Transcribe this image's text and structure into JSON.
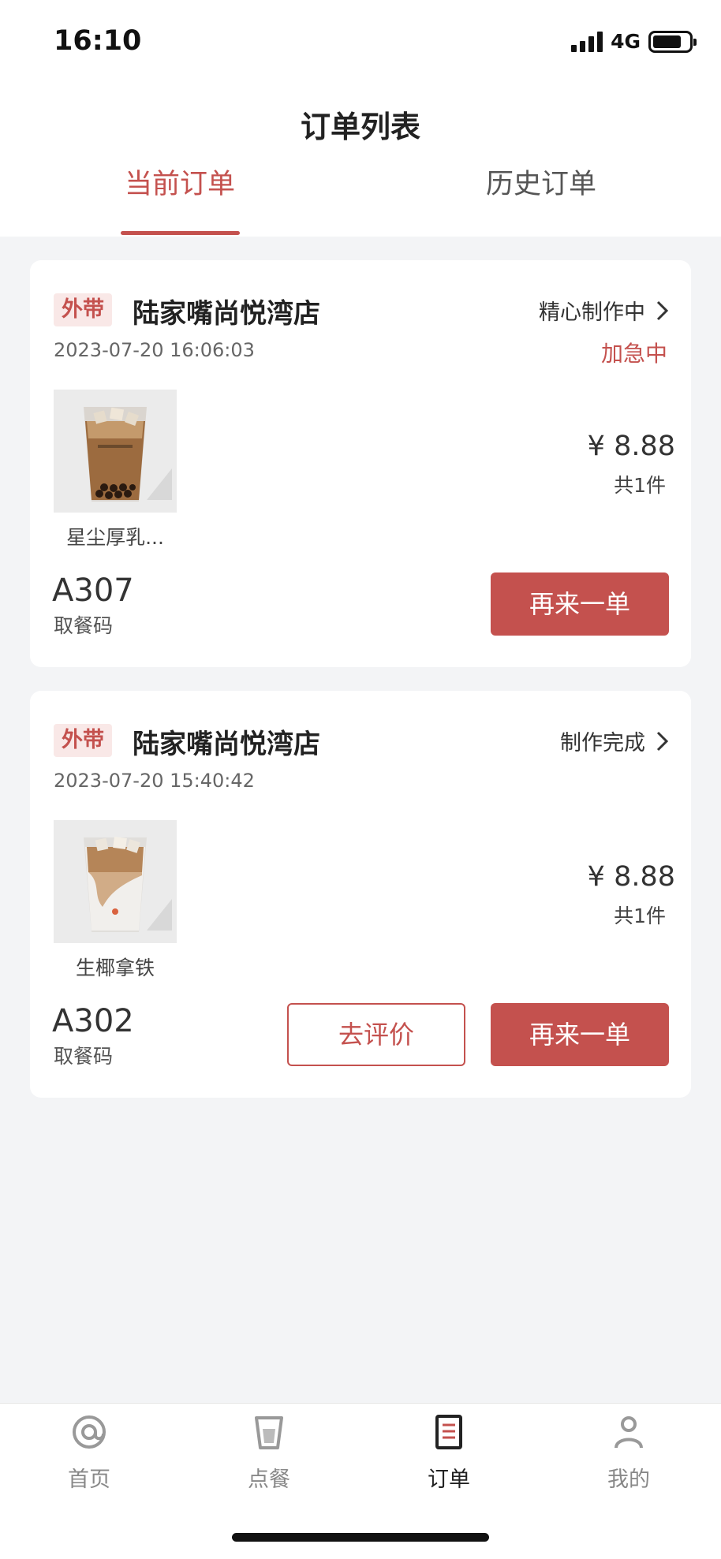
{
  "status_bar": {
    "time": "16:10",
    "network": "4G"
  },
  "header": {
    "title": "订单列表",
    "tabs": [
      {
        "label": "当前订单",
        "active": true
      },
      {
        "label": "历史订单",
        "active": false
      }
    ]
  },
  "colors": {
    "accent": "#c4514e",
    "tag_bg": "#f9e8e7",
    "background": "#f3f4f6"
  },
  "orders": [
    {
      "tag": "外带",
      "store": "陆家嘴尚悦湾店",
      "status": "精心制作中",
      "time": "2023-07-20 16:06:03",
      "rush": "加急中",
      "product": {
        "name": "星尘厚乳...",
        "icon": "iced-coffee-with-boba"
      },
      "price": "¥ 8.88",
      "quantity": "共1件",
      "pickup_code": "A307",
      "pickup_label": "取餐码",
      "reorder_label": "再来一单"
    },
    {
      "tag": "外带",
      "store": "陆家嘴尚悦湾店",
      "status": "制作完成",
      "time": "2023-07-20 15:40:42",
      "product": {
        "name": "生椰拿铁",
        "icon": "iced-coconut-latte"
      },
      "price": "¥ 8.88",
      "quantity": "共1件",
      "pickup_code": "A302",
      "pickup_label": "取餐码",
      "review_label": "去评价",
      "reorder_label": "再来一单"
    }
  ],
  "tab_bar": {
    "items": [
      {
        "label": "首页",
        "icon": "at-sign-icon",
        "active": false
      },
      {
        "label": "点餐",
        "icon": "cup-icon",
        "active": false
      },
      {
        "label": "订单",
        "icon": "receipt-icon",
        "active": true
      },
      {
        "label": "我的",
        "icon": "user-icon",
        "active": false
      }
    ]
  }
}
